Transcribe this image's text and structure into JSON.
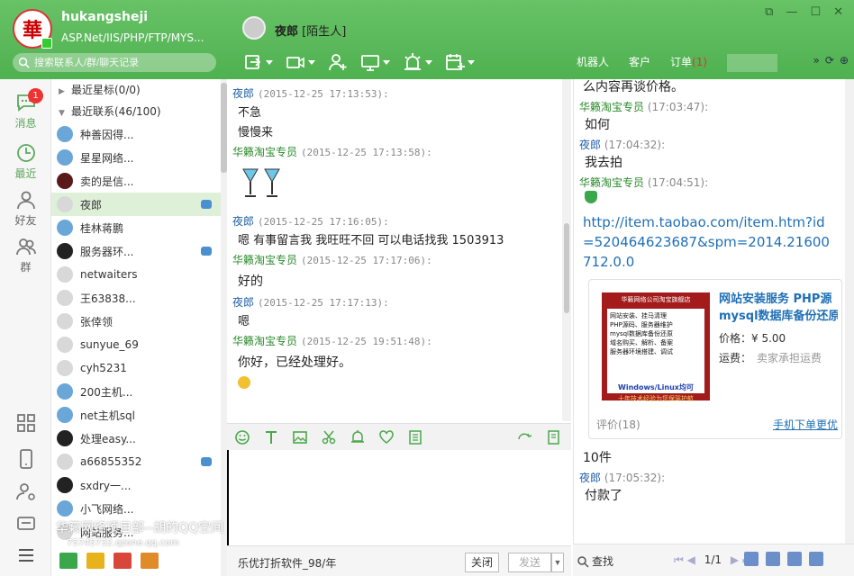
{
  "self": {
    "name": "hukangsheji",
    "signature": "ASP.Net/IIS/PHP/FTP/MYS...",
    "avatar_char": "華",
    "search_placeholder": "搜索联系人/群/聊天记录"
  },
  "conversation": {
    "contact_name": "夜郎",
    "contact_tag": "[陌生人]"
  },
  "right_tabs": [
    "机器人",
    "客户",
    "订单"
  ],
  "order_badge": "(1)",
  "nav": {
    "messages": "消息",
    "messages_badge": "1",
    "recent": "最近",
    "friends": "好友",
    "groups": "群"
  },
  "contacts": {
    "group_star": "最近星标(0/0)",
    "group_recent": "最近联系(46/100)",
    "items": [
      {
        "name": "种善因得..."
      },
      {
        "name": "星星网络..."
      },
      {
        "name": "卖的是信..."
      },
      {
        "name": "夜郎"
      },
      {
        "name": "桂林蒋鹏"
      },
      {
        "name": "服务器环..."
      },
      {
        "name": "netwaiters"
      },
      {
        "name": "王63838..."
      },
      {
        "name": "张倖领"
      },
      {
        "name": "sunyue_69"
      },
      {
        "name": "cyh5231"
      },
      {
        "name": "200主机..."
      },
      {
        "name": "net主机sql"
      },
      {
        "name": "处理easy..."
      },
      {
        "name": "a66855352"
      },
      {
        "name": "sxdry一..."
      },
      {
        "name": "小飞网络..."
      },
      {
        "name": "网站服务..."
      }
    ]
  },
  "watermark": {
    "line1": "华籁网络项目部--胡的QQ空间",
    "line2": "75745732.qzone.qq.com"
  },
  "chat": {
    "messages": [
      {
        "who": "夜郎",
        "time": "(2015-12-25 17:13:53):",
        "lines": [
          "不急",
          "慢慢来"
        ]
      },
      {
        "who": "华籁淘宝专员",
        "time": "(2015-12-25 17:13:58):",
        "lines": []
      },
      {
        "who": "夜郎",
        "time": "(2015-12-25 17:16:05):",
        "lines": [
          "嗯 有事留言我  我旺旺不回 可以电话找我 1503913"
        ]
      },
      {
        "who": "华籁淘宝专员",
        "time": "(2015-12-25 17:17:06):",
        "lines": [
          "好的"
        ]
      },
      {
        "who": "夜郎",
        "time": "(2015-12-25 17:17:13):",
        "lines": [
          "嗯"
        ]
      },
      {
        "who": "华籁淘宝专员",
        "time": "(2015-12-25 19:51:48):",
        "lines": [
          "你好，已经处理好。"
        ]
      }
    ]
  },
  "bottom": {
    "ad": "乐优打折软件_98/年",
    "close": "关闭",
    "send": "发送"
  },
  "history": {
    "top_line": "么内容再谈价格。",
    "m1_who": "华籁淘宝专员",
    "m1_time": "(17:03:47):",
    "m1_text": "如何",
    "m2_who": "夜郎",
    "m2_time": "(17:04:32):",
    "m2_text": "我去拍",
    "m3_who": "华籁淘宝专员",
    "m3_time": "(17:04:51):",
    "link": "http://item.taobao.com/item.htm?id=520464623687&spm=2014.21600712.0.0",
    "card_title": "网站安装服务 PHP源",
    "card_title2": "mysql数据库备份还原",
    "card_price_label": "价格：",
    "card_price": "¥ 5.00",
    "card_ship_label": "运费：",
    "card_ship": "卖家承担运费",
    "card_review": "评价(18)",
    "card_mobile": "手机下单更优",
    "card_img_header": "华籁网络公司淘宝旗舰店",
    "card_img_lines": [
      "网站安装、挂马清理",
      "PHP源码、服务器维护",
      "mysql数据库备份还原",
      "域名购买、解析、备案",
      "服务器环境搭建、调试"
    ],
    "card_img_footer": "Windows/Linux均可",
    "card_img_bottom": "十年技术经验为您保驾护航",
    "m4_text": "10件",
    "m5_who": "夜郎",
    "m5_time": "(17:05:32):",
    "m5_text": "付款了",
    "search": "查找",
    "page": "1/1"
  }
}
